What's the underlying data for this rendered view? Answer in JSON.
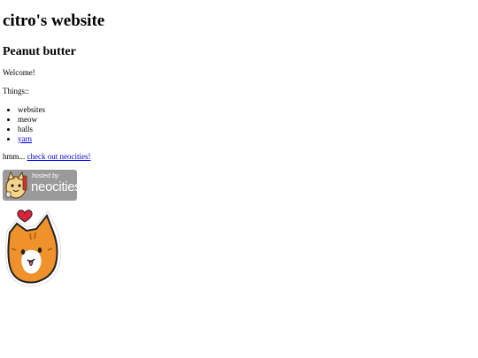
{
  "site": {
    "title": "citro's website",
    "heading": "Peanut butter",
    "welcome": "Welcome!",
    "things_label": "Things::",
    "things": [
      {
        "label": "websites",
        "is_link": false
      },
      {
        "label": "meow",
        "is_link": false
      },
      {
        "label": "balls",
        "is_link": false
      },
      {
        "label": "yarn",
        "is_link": true
      }
    ],
    "hmm_prefix": "hmm... ",
    "neocities_link": "check out neocities!"
  },
  "badge": {
    "hosted_by": "hosted by",
    "brand": "neocities",
    "color": "#9a9a9a"
  },
  "sticker": {
    "icon": "orange-cat-heart-sticker"
  },
  "colors": {
    "link": "#0000ee",
    "cat_orange": "#f0922b",
    "heart_red": "#d8233a"
  }
}
